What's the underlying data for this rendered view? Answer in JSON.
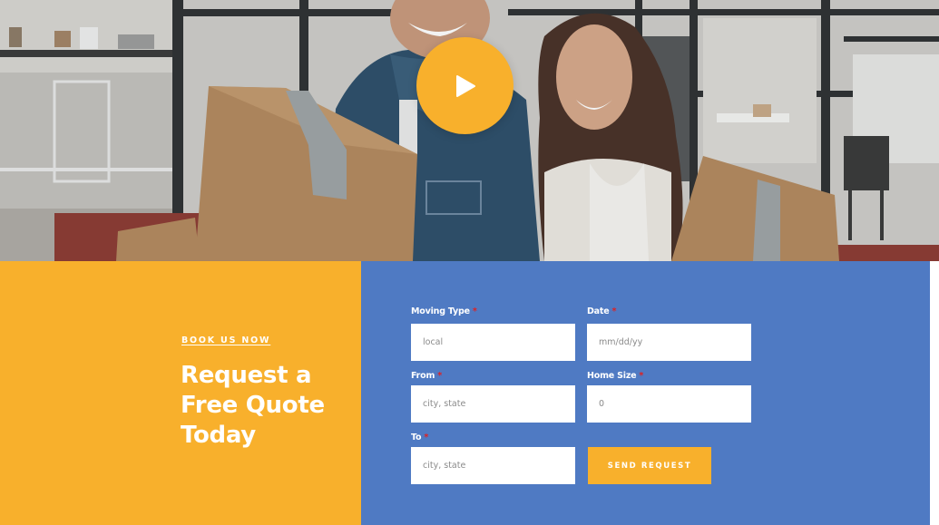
{
  "hero": {
    "play_icon": "play-icon",
    "colors": {
      "play_button": "#f8b02c"
    }
  },
  "cta": {
    "eyebrow": "BOOK US NOW",
    "headline": "Request a Free Quote Today",
    "background": "#f8b02c"
  },
  "form": {
    "background": "#4f7ac3",
    "required_marker": "*",
    "moving_type": {
      "label": "Moving Type",
      "value": "local"
    },
    "date": {
      "label": "Date",
      "placeholder": "mm/dd/yy"
    },
    "from": {
      "label": "From",
      "placeholder": "city, state"
    },
    "home_size": {
      "label": "Home Size",
      "value": "0"
    },
    "to": {
      "label": "To",
      "placeholder": "city, state"
    },
    "submit_label": "SEND REQUEST"
  }
}
